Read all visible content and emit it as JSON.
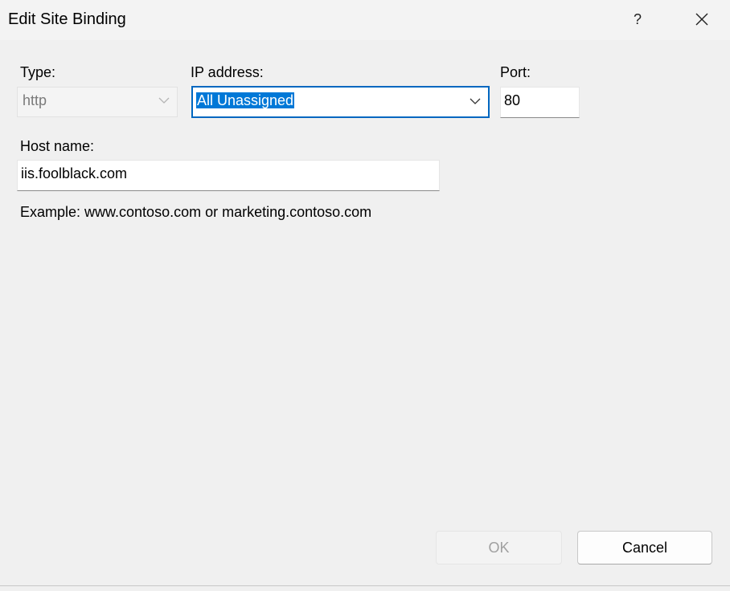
{
  "window": {
    "title": "Edit Site Binding",
    "help_label": "?",
    "close_icon": "close-icon"
  },
  "form": {
    "type": {
      "label": "Type:",
      "value": "http",
      "enabled": false
    },
    "ip_address": {
      "label": "IP address:",
      "value": "All Unassigned",
      "text_selected": true
    },
    "port": {
      "label": "Port:",
      "value": "80"
    },
    "host_name": {
      "label": "Host name:",
      "value": "iis.foolblack.com"
    },
    "example": "Example: www.contoso.com or marketing.contoso.com"
  },
  "buttons": {
    "ok_label": "OK",
    "ok_enabled": false,
    "cancel_label": "Cancel"
  },
  "colors": {
    "accent": "#0067c0",
    "selection": "#0078d7",
    "background": "#f0f0f0"
  }
}
